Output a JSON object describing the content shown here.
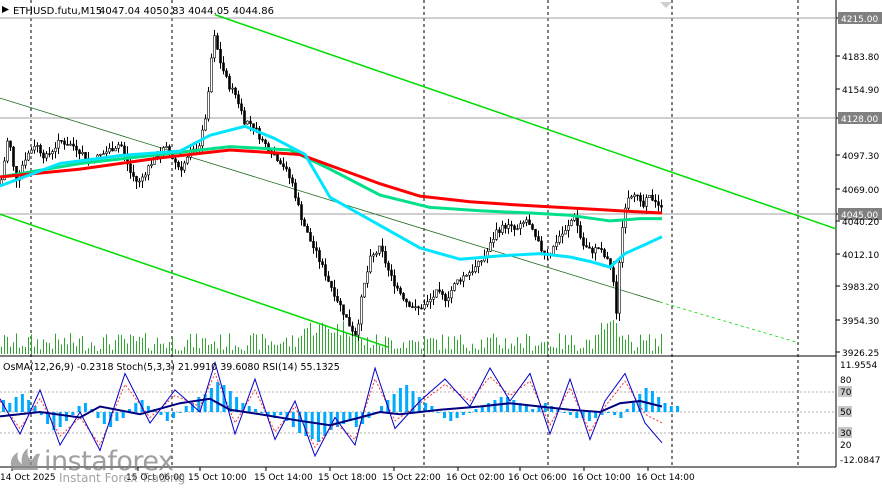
{
  "symbol": "ETHUSD.futu,M15",
  "ohlc": "4047.04 4050.83 4044.05 4044.86",
  "indicator_label": "OsMA(12,26,9) -0.2318  Stoch(5,3,3) 21.9910 39.6080  RSI(14) 55.1325",
  "watermark": {
    "brand": "instaforex",
    "tagline": "Instant Forex Trading"
  },
  "colors": {
    "candle": "#000000",
    "ma_fast": "#00e5ff",
    "ma_mid": "#00e08a",
    "ma_slow": "#ff0000",
    "channel": "#00dd00",
    "osma": "#00aaff",
    "stoch_main": "#0000c8",
    "stoch_signal": "#ff3030",
    "rsi": "#000080",
    "price_label_bg": "#808080"
  },
  "chart_data": {
    "type": "candlestick",
    "title": "ETHUSD.futu,M15",
    "ylim": [
      3920,
      4228
    ],
    "price_ticks": [
      "4215.00",
      "4183.80",
      "4154.90",
      "4128.00",
      "4097.30",
      "4069.00",
      "4045.00",
      "4040.20",
      "4012.10",
      "3983.20",
      "3954.30",
      "3926.25"
    ],
    "highlighted_prices": [
      "4215.00",
      "4128.00",
      "4045.00"
    ],
    "time_labels": [
      "14 Oct 2025",
      "15 Oct 06:00",
      "15 Oct 10:00",
      "15 Oct 14:00",
      "15 Oct 18:00",
      "15 Oct 22:00",
      "16 Oct 02:00",
      "16 Oct 06:00",
      "16 Oct 10:00",
      "16 Oct 14:00"
    ],
    "price_path": [
      [
        0,
        4070
      ],
      [
        8,
        4115
      ],
      [
        15,
        4075
      ],
      [
        25,
        4095
      ],
      [
        35,
        4108
      ],
      [
        45,
        4095
      ],
      [
        60,
        4110
      ],
      [
        75,
        4105
      ],
      [
        90,
        4092
      ],
      [
        105,
        4100
      ],
      [
        120,
        4108
      ],
      [
        130,
        4082
      ],
      [
        138,
        4072
      ],
      [
        150,
        4090
      ],
      [
        165,
        4104
      ],
      [
        180,
        4085
      ],
      [
        190,
        4098
      ],
      [
        200,
        4108
      ],
      [
        207,
        4140
      ],
      [
        213,
        4205
      ],
      [
        220,
        4180
      ],
      [
        228,
        4160
      ],
      [
        236,
        4150
      ],
      [
        244,
        4128
      ],
      [
        252,
        4125
      ],
      [
        262,
        4110
      ],
      [
        272,
        4100
      ],
      [
        282,
        4090
      ],
      [
        292,
        4072
      ],
      [
        300,
        4045
      ],
      [
        308,
        4025
      ],
      [
        316,
        4010
      ],
      [
        326,
        3990
      ],
      [
        334,
        3975
      ],
      [
        342,
        3960
      ],
      [
        350,
        3945
      ],
      [
        356,
        3938
      ],
      [
        362,
        3975
      ],
      [
        370,
        4005
      ],
      [
        380,
        4015
      ],
      [
        390,
        3990
      ],
      [
        398,
        3978
      ],
      [
        406,
        3968
      ],
      [
        416,
        3960
      ],
      [
        426,
        3965
      ],
      [
        436,
        3975
      ],
      [
        446,
        3970
      ],
      [
        456,
        3985
      ],
      [
        466,
        3992
      ],
      [
        476,
        3998
      ],
      [
        486,
        4010
      ],
      [
        496,
        4030
      ],
      [
        506,
        4035
      ],
      [
        516,
        4030
      ],
      [
        526,
        4040
      ],
      [
        534,
        4025
      ],
      [
        542,
        4012
      ],
      [
        550,
        4010
      ],
      [
        558,
        4025
      ],
      [
        566,
        4030
      ],
      [
        574,
        4045
      ],
      [
        582,
        4018
      ],
      [
        590,
        4012
      ],
      [
        598,
        4015
      ],
      [
        606,
        4005
      ],
      [
        612,
        3995
      ],
      [
        616,
        3955
      ],
      [
        620,
        4020
      ],
      [
        626,
        4060
      ],
      [
        634,
        4065
      ],
      [
        642,
        4050
      ],
      [
        648,
        4060
      ],
      [
        655,
        4058
      ],
      [
        662,
        4048
      ]
    ],
    "ma_slow": [
      [
        0,
        4078
      ],
      [
        80,
        4085
      ],
      [
        160,
        4095
      ],
      [
        230,
        4102
      ],
      [
        300,
        4098
      ],
      [
        340,
        4085
      ],
      [
        380,
        4072
      ],
      [
        420,
        4061
      ],
      [
        470,
        4056
      ],
      [
        520,
        4053
      ],
      [
        560,
        4051
      ],
      [
        600,
        4049
      ],
      [
        640,
        4047
      ],
      [
        662,
        4046
      ]
    ],
    "ma_mid": [
      [
        0,
        4078
      ],
      [
        80,
        4090
      ],
      [
        160,
        4098
      ],
      [
        230,
        4105
      ],
      [
        290,
        4102
      ],
      [
        330,
        4085
      ],
      [
        380,
        4062
      ],
      [
        430,
        4051
      ],
      [
        480,
        4048
      ],
      [
        530,
        4046
      ],
      [
        570,
        4044
      ],
      [
        610,
        4039
      ],
      [
        640,
        4041
      ],
      [
        662,
        4041
      ]
    ],
    "ma_fast": [
      [
        0,
        4070
      ],
      [
        60,
        4090
      ],
      [
        120,
        4097
      ],
      [
        180,
        4101
      ],
      [
        210,
        4115
      ],
      [
        245,
        4123
      ],
      [
        275,
        4112
      ],
      [
        305,
        4098
      ],
      [
        330,
        4060
      ],
      [
        360,
        4045
      ],
      [
        390,
        4030
      ],
      [
        420,
        4015
      ],
      [
        460,
        4005
      ],
      [
        500,
        4008
      ],
      [
        540,
        4010
      ],
      [
        570,
        4007
      ],
      [
        590,
        4003
      ],
      [
        610,
        3998
      ],
      [
        625,
        4010
      ],
      [
        645,
        4018
      ],
      [
        662,
        4025
      ]
    ],
    "channel_upper": [
      [
        215,
        4222
      ],
      [
        836,
        4032
      ]
    ],
    "channel_mid": [
      [
        0,
        4148
      ],
      [
        660,
        3967
      ]
    ],
    "channel_mid_dashed": [
      [
        660,
        3967
      ],
      [
        798,
        3931
      ]
    ],
    "channel_lower": [
      [
        0,
        4045
      ],
      [
        388,
        3927
      ]
    ],
    "sub_panel": {
      "ylim": [
        -12.0847,
        11.9554
      ],
      "tick_labels": [
        "11.9554",
        "80",
        "70",
        "50",
        "30",
        "20",
        "-12.0847"
      ],
      "osma_histogram": [
        4,
        3,
        5,
        6,
        4,
        2,
        -1,
        -4,
        -6,
        -5,
        -3,
        -1,
        2,
        3,
        1,
        -2,
        -4,
        -5,
        -3,
        -2,
        1,
        3,
        4,
        2,
        1,
        -1,
        -3,
        -2,
        0,
        2,
        3,
        5,
        6,
        8,
        10,
        9,
        7,
        5,
        3,
        2,
        1,
        0,
        -1,
        -2,
        -1,
        -3,
        -5,
        -7,
        -8,
        -9,
        -10,
        -8,
        -6,
        -5,
        -4,
        -3,
        -5,
        -4,
        -2,
        0,
        2,
        4,
        6,
        8,
        9,
        7,
        5,
        3,
        2,
        0,
        -2,
        -3,
        -2,
        -1,
        0,
        1,
        2,
        3,
        4,
        5,
        5,
        4,
        3,
        2,
        1,
        2,
        3,
        2,
        1,
        0,
        -1,
        -2,
        -2,
        -3,
        -2,
        -1,
        0,
        -1,
        -2,
        1,
        3,
        6,
        8,
        7,
        5,
        3,
        2,
        2
      ],
      "rsi": [
        [
          0,
          46
        ],
        [
          40,
          50
        ],
        [
          80,
          45
        ],
        [
          100,
          55
        ],
        [
          140,
          48
        ],
        [
          180,
          58
        ],
        [
          210,
          62
        ],
        [
          230,
          52
        ],
        [
          260,
          48
        ],
        [
          300,
          42
        ],
        [
          330,
          38
        ],
        [
          360,
          45
        ],
        [
          380,
          50
        ],
        [
          400,
          48
        ],
        [
          440,
          52
        ],
        [
          480,
          55
        ],
        [
          510,
          58
        ],
        [
          540,
          55
        ],
        [
          570,
          52
        ],
        [
          600,
          50
        ],
        [
          620,
          58
        ],
        [
          640,
          60
        ],
        [
          662,
          55
        ]
      ],
      "stoch_main": [
        [
          0,
          62
        ],
        [
          20,
          30
        ],
        [
          40,
          70
        ],
        [
          60,
          20
        ],
        [
          80,
          50
        ],
        [
          100,
          15
        ],
        [
          125,
          85
        ],
        [
          150,
          40
        ],
        [
          175,
          70
        ],
        [
          200,
          50
        ],
        [
          215,
          95
        ],
        [
          235,
          30
        ],
        [
          255,
          80
        ],
        [
          275,
          25
        ],
        [
          295,
          60
        ],
        [
          315,
          10
        ],
        [
          335,
          45
        ],
        [
          355,
          20
        ],
        [
          375,
          90
        ],
        [
          395,
          35
        ],
        [
          420,
          60
        ],
        [
          445,
          80
        ],
        [
          470,
          55
        ],
        [
          490,
          90
        ],
        [
          510,
          60
        ],
        [
          530,
          85
        ],
        [
          550,
          30
        ],
        [
          570,
          80
        ],
        [
          590,
          25
        ],
        [
          605,
          60
        ],
        [
          625,
          85
        ],
        [
          645,
          40
        ],
        [
          662,
          22
        ]
      ],
      "stoch_signal": [
        [
          0,
          60
        ],
        [
          20,
          35
        ],
        [
          40,
          62
        ],
        [
          60,
          28
        ],
        [
          80,
          45
        ],
        [
          100,
          20
        ],
        [
          125,
          75
        ],
        [
          150,
          45
        ],
        [
          175,
          65
        ],
        [
          200,
          55
        ],
        [
          215,
          85
        ],
        [
          235,
          40
        ],
        [
          255,
          70
        ],
        [
          275,
          32
        ],
        [
          295,
          55
        ],
        [
          315,
          18
        ],
        [
          335,
          40
        ],
        [
          355,
          25
        ],
        [
          375,
          80
        ],
        [
          395,
          42
        ],
        [
          420,
          58
        ],
        [
          445,
          75
        ],
        [
          470,
          60
        ],
        [
          490,
          82
        ],
        [
          510,
          65
        ],
        [
          530,
          78
        ],
        [
          550,
          38
        ],
        [
          570,
          72
        ],
        [
          590,
          32
        ],
        [
          605,
          55
        ],
        [
          625,
          78
        ],
        [
          645,
          48
        ],
        [
          662,
          40
        ]
      ]
    }
  }
}
